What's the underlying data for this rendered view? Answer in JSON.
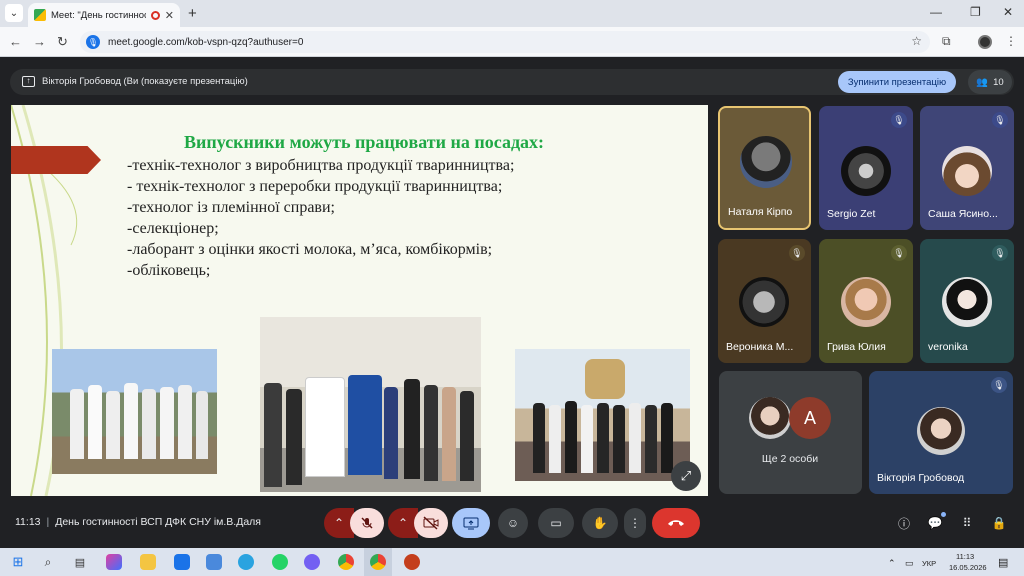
{
  "browser": {
    "tab_title": "Meet: \"День гостинності В",
    "tab_close": "✕",
    "new_tab": "+",
    "url": "meet.google.com/kob-vspn-qzq?authuser=0",
    "window_controls": [
      "—",
      "❐",
      "✕"
    ]
  },
  "meet": {
    "presenter_text": "Вікторія Гробовод (Ви (показуєте презентацію)",
    "stop_button": "Зупинити презентацію",
    "participants_count": "10",
    "time": "11:13",
    "separator": "|",
    "meeting_title": "День гостинності ВСП ДФК СНУ ім.В.Даля"
  },
  "slide": {
    "title": "Випускники можуть працювати на посадах:",
    "items": [
      "-технік-технолог з виробництва продукції тваринництва;",
      "- технік-технолог з переробки продукції тваринництва;",
      "-технолог із племінної справи;",
      "-селекціонер;",
      "-лаборант з оцінки якості молока, м’яса, комбікормів;",
      "-обліковець;"
    ]
  },
  "tiles": [
    {
      "name": "Наталя Кірпо",
      "muted": false
    },
    {
      "name": "Sergio Zet",
      "muted": true
    },
    {
      "name": "Саша Ясино...",
      "muted": true
    },
    {
      "name": "Вероника М...",
      "muted": true
    },
    {
      "name": "Грива Юлия",
      "muted": true
    },
    {
      "name": "veronika",
      "muted": true
    },
    {
      "name": "Вікторія Гробовод",
      "muted": true
    }
  ],
  "more": {
    "letter": "A",
    "text": "Ще 2 особи"
  },
  "taskbar": {
    "lang": "УКР",
    "clock_time": "11:13",
    "clock_date": "16.05.2026"
  },
  "colors": {
    "accent_blue": "#a8c7fa",
    "end_call_red": "#dc362e",
    "slide_title_green": "#1fa845",
    "slide_arrow": "#b0351e"
  }
}
